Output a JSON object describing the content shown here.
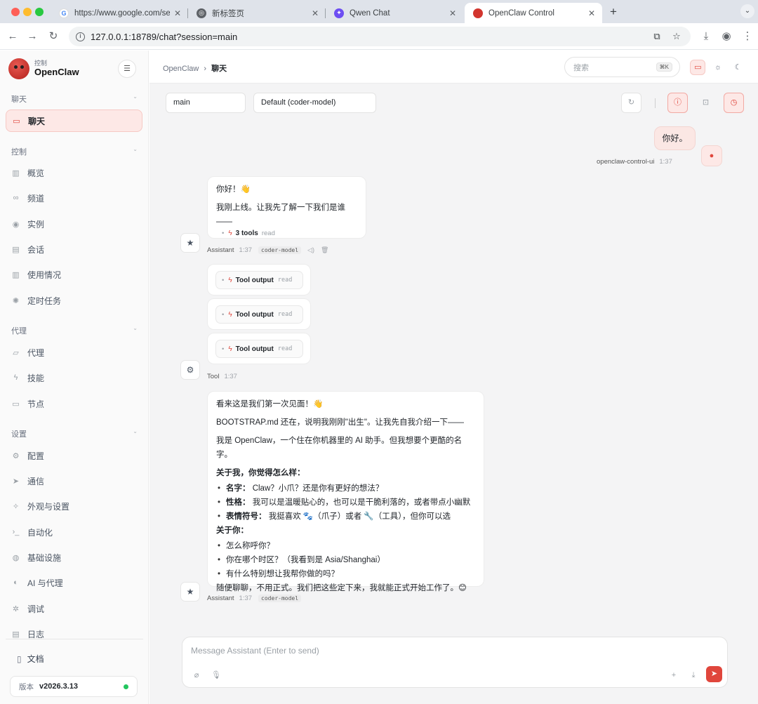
{
  "browser": {
    "tabs": [
      {
        "title": "https://www.google.com/sear",
        "icon": "google-icon"
      },
      {
        "title": "新标签页",
        "icon": "chrome-icon"
      },
      {
        "title": "Qwen Chat",
        "icon": "qwen-icon"
      },
      {
        "title": "OpenClaw Control",
        "icon": "openclaw-icon"
      }
    ],
    "url": "127.0.0.1:18789/chat?session=main"
  },
  "sidebar": {
    "brand_sub": "控制",
    "brand_name": "OpenClaw",
    "sections": {
      "chat": "聊天",
      "control": "控制",
      "agent": "代理",
      "settings": "设置"
    },
    "items": {
      "chat": "聊天",
      "overview": "概览",
      "channels": "频道",
      "instances": "实例",
      "sessions": "会话",
      "usage": "使用情况",
      "cron": "定时任务",
      "agents": "代理",
      "skills": "技能",
      "nodes": "节点",
      "config": "配置",
      "comms": "通信",
      "appearance": "外观与设置",
      "automation": "自动化",
      "infra": "基础设施",
      "ai_agents": "AI 与代理",
      "debug": "调试",
      "logs": "日志"
    },
    "docs": "文档",
    "version_label": "版本",
    "version": "v2026.3.13",
    "status_color": "#22c55e"
  },
  "header": {
    "breadcrumb_root": "OpenClaw",
    "breadcrumb_sep": "›",
    "breadcrumb_current": "聊天",
    "search_placeholder": "搜索",
    "search_shortcut": "⌘K"
  },
  "toolbar": {
    "session": "main",
    "model": "Default (coder-model)"
  },
  "chat": {
    "user_message": "你好。",
    "user_name": "openclaw-control-ui",
    "user_time": "1:37",
    "assistant1": {
      "line1": "你好！👋",
      "line2": "我刚上线。让我先了解一下我们是谁——",
      "tools_label": "3 tools",
      "tools_kind": "read",
      "name": "Assistant",
      "time": "1:37",
      "model": "coder-model"
    },
    "tool_outputs": [
      {
        "label": "Tool output",
        "kind": "read"
      },
      {
        "label": "Tool output",
        "kind": "read"
      },
      {
        "label": "Tool output",
        "kind": "read"
      }
    ],
    "tool_name": "Tool",
    "tool_time": "1:37",
    "assistant2": {
      "p1": "看来这是我们第一次见面！👋",
      "p2": "BOOTSTRAP.md 还在，说明我刚刚\"出生\"。让我先自我介绍一下——",
      "p3": "我是 OpenClaw，一个住在你机器里的 AI 助手。但我想要个更酷的名字。",
      "h1": "关于我，你觉得怎么样：",
      "b1_key": "名字：",
      "b1_val": " Claw？小爪？还是你有更好的想法？",
      "b2_key": "性格：",
      "b2_val": " 我可以是温暖贴心的，也可以是干脆利落的，或者带点小幽默",
      "b3_key": "表情符号：",
      "b3_val": " 我挺喜欢 🐾（爪子）或者 🔧（工具），但你可以选",
      "h2": "关于你：",
      "q1": "怎么称呼你？",
      "q2": "你在哪个时区？（我看到是 Asia/Shanghai）",
      "q3": "有什么特别想让我帮你做的吗？",
      "closing": "随便聊聊，不用正式。我们把这些定下来，我就能正式开始工作了。😊",
      "name": "Assistant",
      "time": "1:37",
      "model": "coder-model"
    }
  },
  "composer": {
    "placeholder": "Message Assistant (Enter to send)"
  },
  "colors": {
    "accent": "#e0463c",
    "accent_soft": "#fde8e6"
  }
}
